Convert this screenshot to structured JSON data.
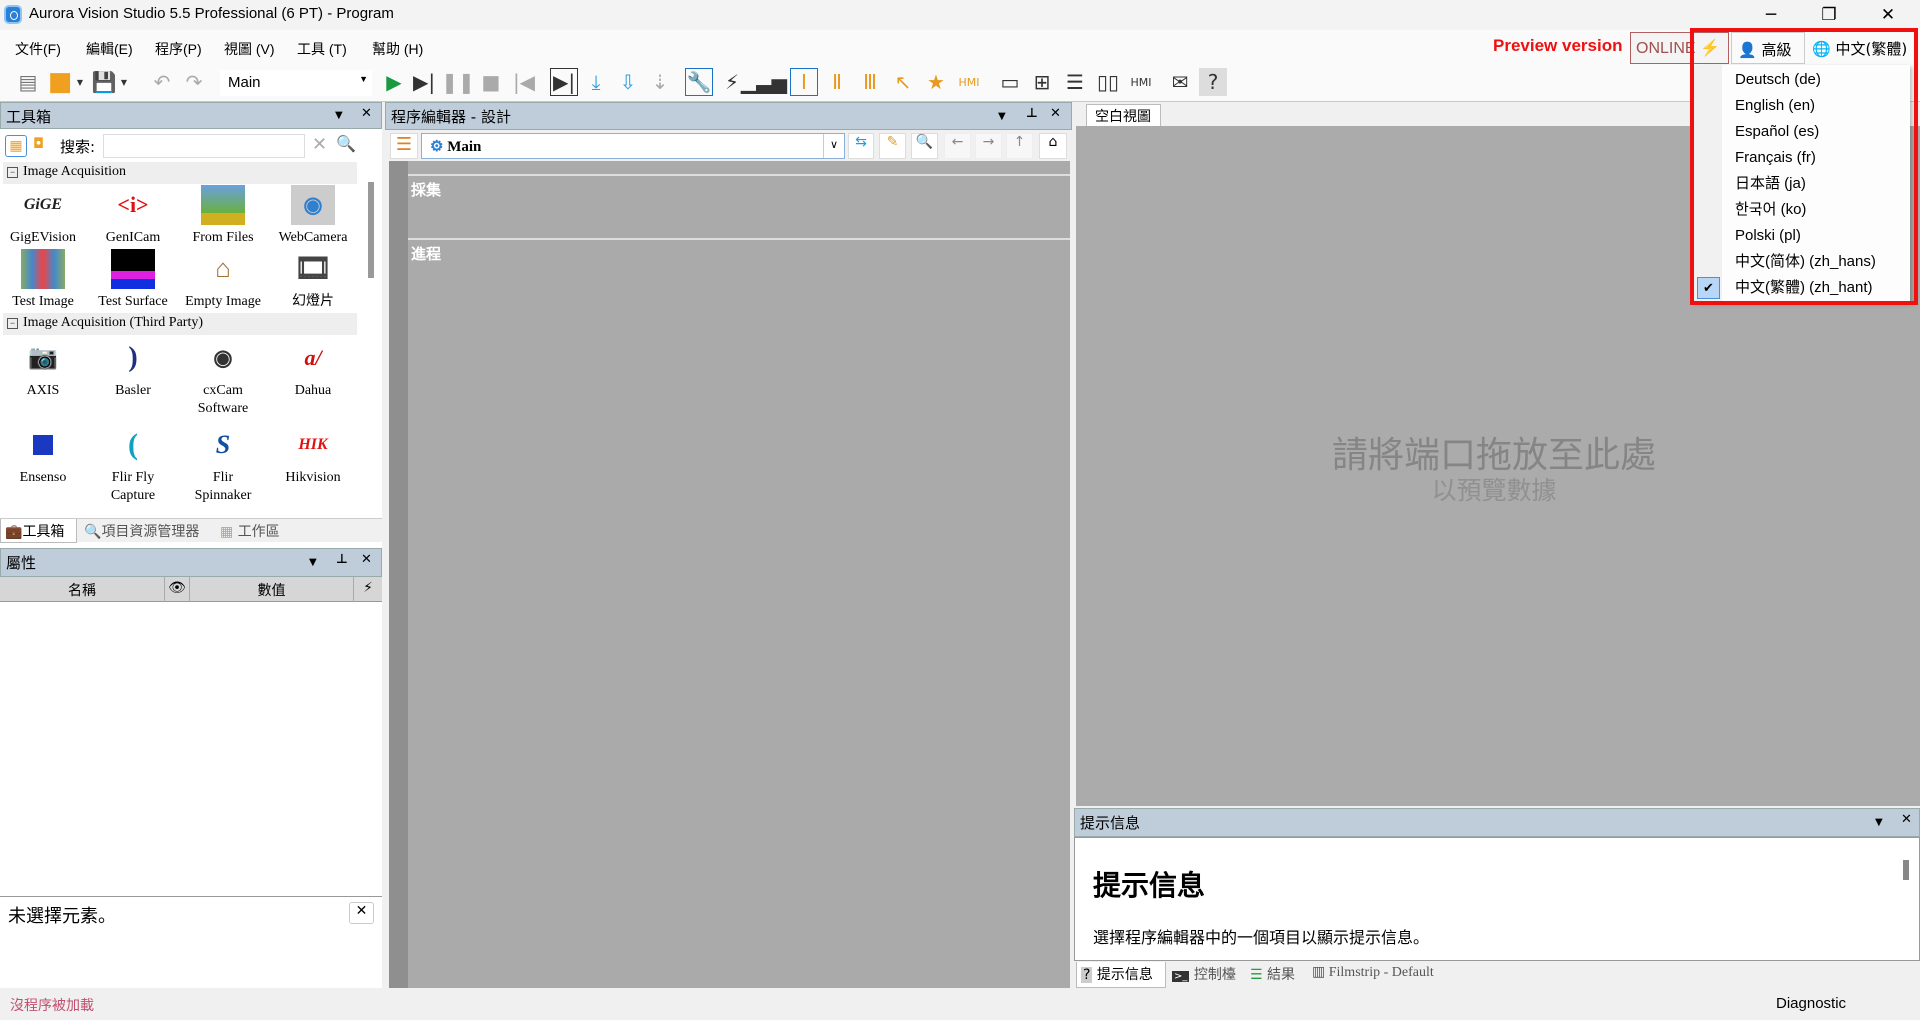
{
  "window": {
    "title": "Aurora Vision Studio 5.5 Professional (6 PT) - Program"
  },
  "menu": [
    "文件(F)",
    "編輯(E)",
    "程序(P)",
    "視圖 (V)",
    "工具 (T)",
    "幫助 (H)"
  ],
  "toolbar": {
    "worker_task": "Main"
  },
  "top_right": {
    "preview": "Preview version",
    "online": "ONLINE",
    "user_level": "高級",
    "language": "中文(繁體)"
  },
  "language_menu": {
    "items": [
      "Deutsch (de)",
      "English (en)",
      "Español (es)",
      "Français (fr)",
      "日本語 (ja)",
      "한국어 (ko)",
      "Polski (pl)",
      "中文(简体) (zh_hans)",
      "中文(繁體) (zh_hant)"
    ],
    "selected": "中文(繁體) (zh_hant)",
    "highlight_color": "#f01010"
  },
  "toolbox": {
    "title": "工具箱",
    "search_label": "搜索:",
    "search_value": "",
    "groups": [
      {
        "name": "Image Acquisition",
        "tools": [
          "GigEVision",
          "GenICam",
          "From Files",
          "WebCamera",
          "Test Image",
          "Test Surface",
          "Empty Image",
          "幻燈片"
        ]
      },
      {
        "name": "Image Acquisition (Third Party)",
        "tools": [
          "AXIS",
          "Basler",
          "cxCam Software",
          "Dahua",
          "Ensenso",
          "Flir Fly Capture",
          "Flir Spinnaker",
          "Hikvision"
        ]
      }
    ],
    "tabs": [
      "工具箱",
      "項目資源管理器",
      "工作區"
    ]
  },
  "properties": {
    "title": "屬性",
    "col_name": "名稱",
    "col_value": "數值",
    "no_selection": "未選擇元素。"
  },
  "editor": {
    "title": "程序編輯器 - 設計",
    "macro": "Main",
    "sections": [
      "採集",
      "進程"
    ]
  },
  "view": {
    "tab": "空白視圖",
    "drop_hint": "請將端口拖放至此處",
    "drop_sub": "以預覽數據"
  },
  "hint_panel": {
    "title": "提示信息",
    "heading": "提示信息",
    "body": "選擇程序編輯器中的一個項目以顯示提示信息。",
    "tabs": [
      "提示信息",
      "控制檯",
      "結果",
      "Filmstrip - Default"
    ]
  },
  "status": {
    "left": "沒程序被加載",
    "right": "Diagnostic"
  }
}
